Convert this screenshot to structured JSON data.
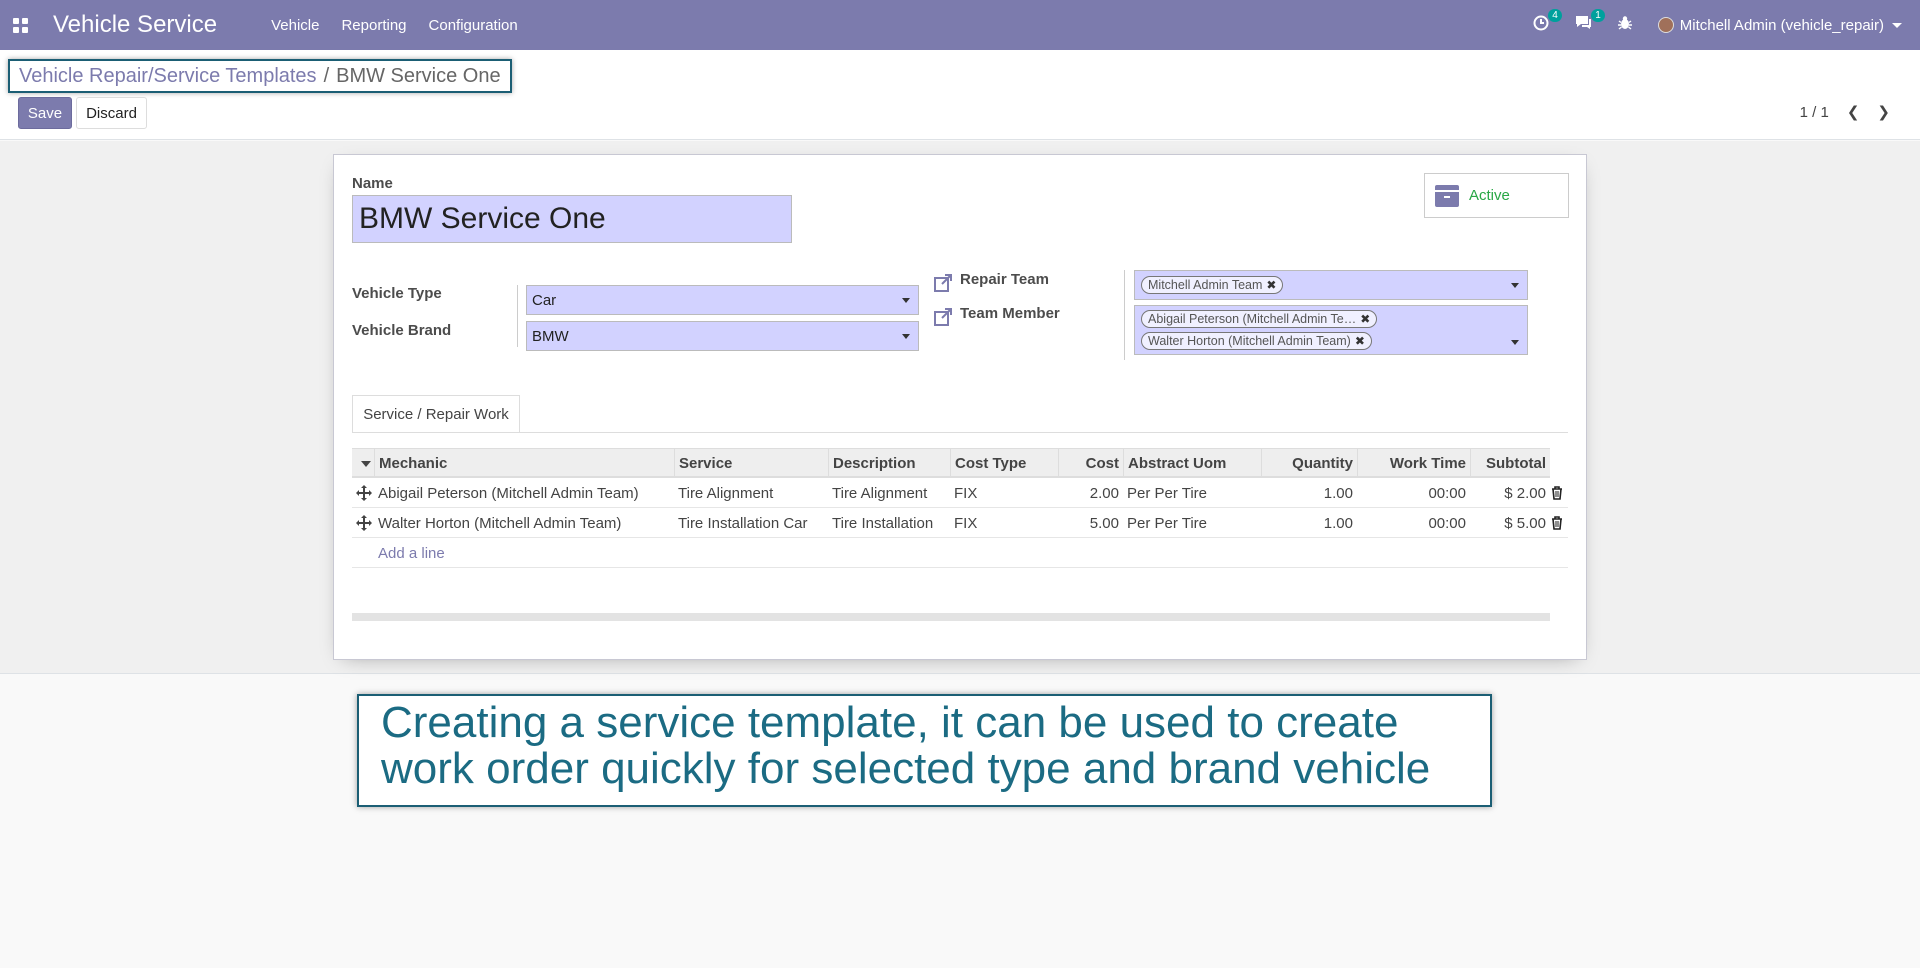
{
  "navbar": {
    "app_title": "Vehicle Service",
    "menu": [
      "Vehicle",
      "Reporting",
      "Configuration"
    ],
    "activity_count": "4",
    "message_count": "1",
    "user_name": "Mitchell Admin (vehicle_repair)"
  },
  "breadcrumb": {
    "parent": "Vehicle Repair/Service Templates",
    "separator": "/",
    "current": "BMW Service One"
  },
  "buttons": {
    "save": "Save",
    "discard": "Discard"
  },
  "pager": {
    "value": "1 / 1"
  },
  "form": {
    "active_label": "Active",
    "name_label": "Name",
    "name_value": "BMW Service One",
    "vehicle_type_label": "Vehicle Type",
    "vehicle_type_value": "Car",
    "vehicle_brand_label": "Vehicle Brand",
    "vehicle_brand_value": "BMW",
    "repair_team_label": "Repair Team",
    "repair_team_tags": [
      "Mitchell Admin Team"
    ],
    "team_member_label": "Team Member",
    "team_member_tags": [
      "Abigail Peterson (Mitchell Admin Te…",
      "Walter Horton (Mitchell Admin Team)"
    ]
  },
  "tabs": [
    "Service / Repair Work"
  ],
  "table": {
    "columns": [
      "Mechanic",
      "Service",
      "Description",
      "Cost Type",
      "Cost",
      "Abstract Uom",
      "Quantity",
      "Work Time",
      "Subtotal"
    ],
    "rows": [
      {
        "mechanic": "Abigail Peterson (Mitchell Admin Team)",
        "service": "Tire Alignment",
        "description": "Tire Alignment",
        "cost_type": "FIX",
        "cost": "2.00",
        "uom": "Per Per Tire",
        "quantity": "1.00",
        "work_time": "00:00",
        "subtotal": "$ 2.00"
      },
      {
        "mechanic": "Walter Horton (Mitchell Admin Team)",
        "service": "Tire Installation Car",
        "description": "Tire Installation",
        "cost_type": "FIX",
        "cost": "5.00",
        "uom": "Per Per Tire",
        "quantity": "1.00",
        "work_time": "00:00",
        "subtotal": "$ 5.00"
      }
    ],
    "add_line": "Add a line"
  },
  "annotation": {
    "line1": "Creating a service template, it can be used to create",
    "line2": "work order quickly for selected type and brand vehicle"
  },
  "colors": {
    "brand": "#7c7bad",
    "input_bg": "#d2d2ff",
    "active_green": "#28a745",
    "annotation_text": "#1b6b83",
    "badge": "#00a09d"
  }
}
